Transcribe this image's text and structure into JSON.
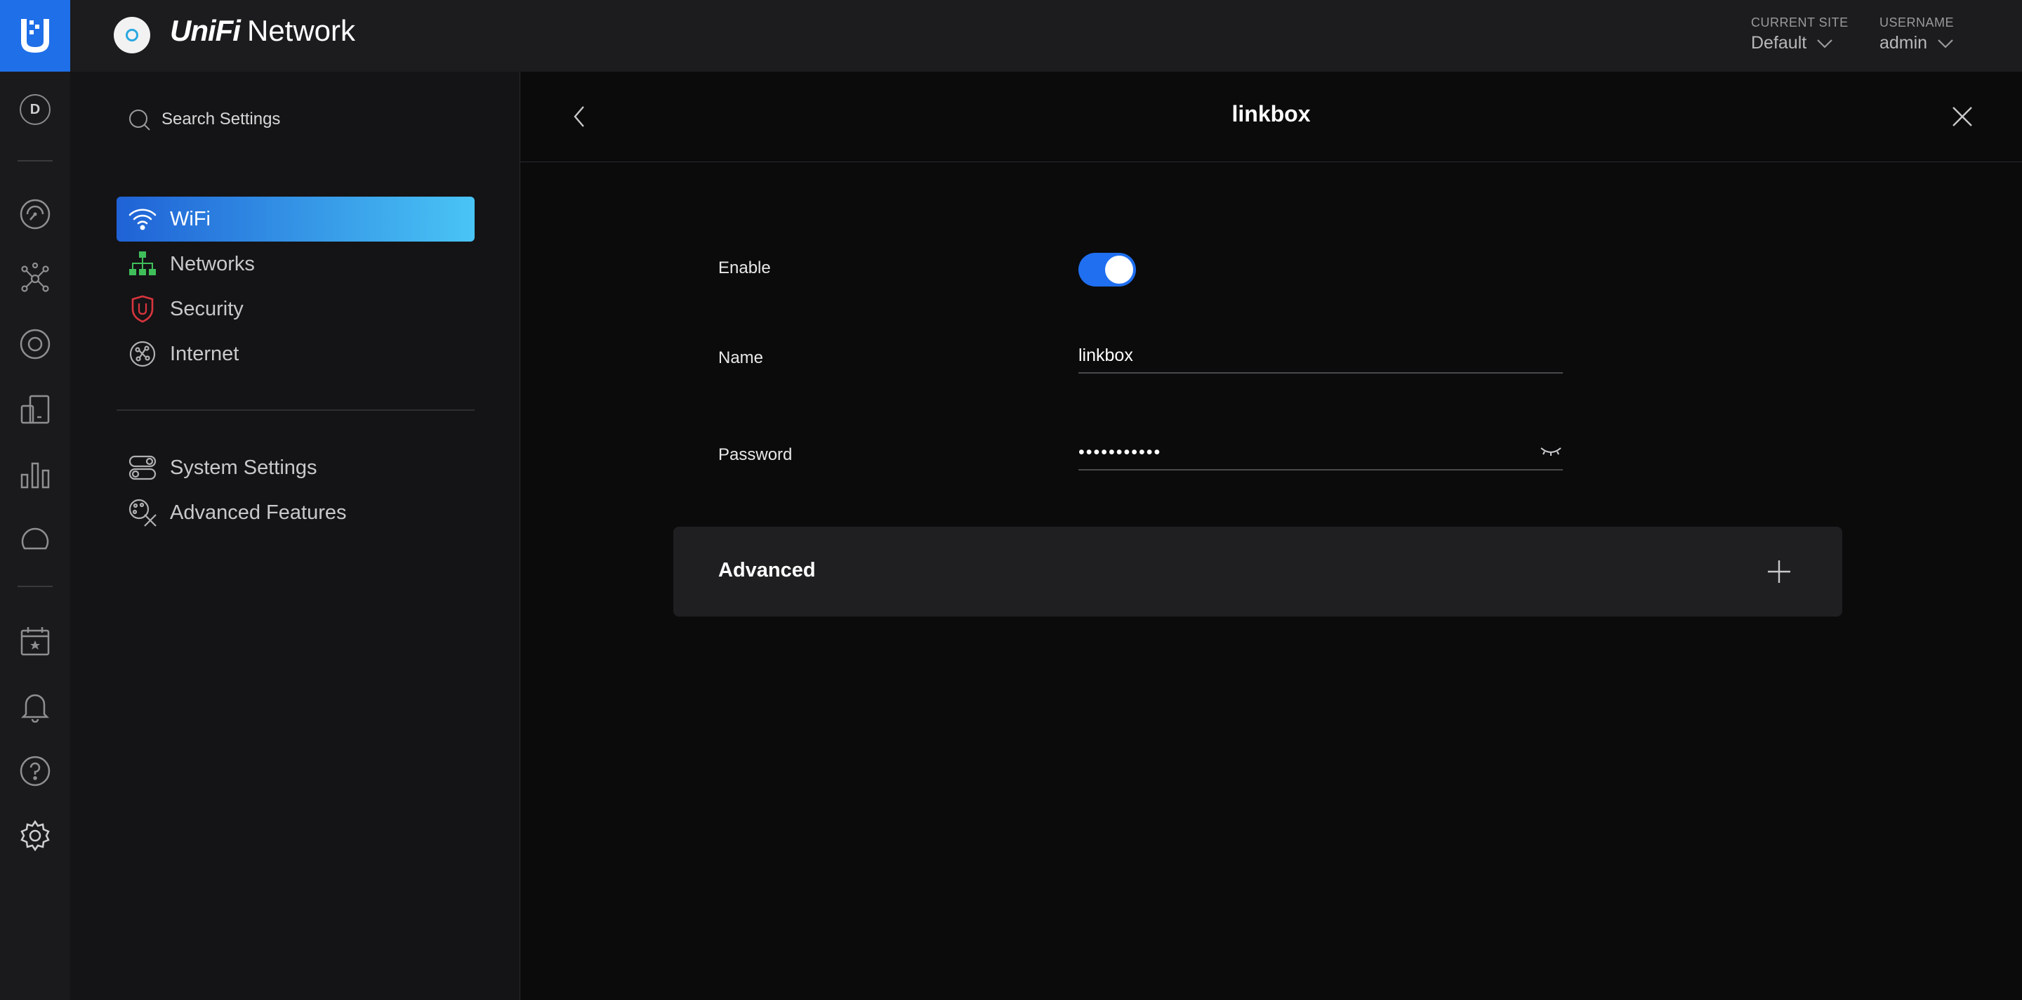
{
  "header": {
    "brand_unifi": "UniFi",
    "brand_network": "Network",
    "current_site_label": "CURRENT SITE",
    "current_site_value": "Default",
    "username_label": "USERNAME",
    "username_value": "admin"
  },
  "rail": {
    "avatar_letter": "D",
    "icons": [
      "dashboard-icon",
      "topology-icon",
      "devices-icon",
      "clients-icon",
      "statistics-icon",
      "insights-icon",
      "events-icon",
      "alerts-icon",
      "help-icon",
      "settings-icon"
    ]
  },
  "settings_nav": {
    "search_placeholder": "Search Settings",
    "items": [
      {
        "label": "WiFi",
        "icon": "wifi-icon",
        "active": true
      },
      {
        "label": "Networks",
        "icon": "networks-icon",
        "color": "#3fbf5a"
      },
      {
        "label": "Security",
        "icon": "shield-icon",
        "color": "#d9353d"
      },
      {
        "label": "Internet",
        "icon": "globe-icon"
      }
    ],
    "items2": [
      {
        "label": "System Settings",
        "icon": "toggles-icon"
      },
      {
        "label": "Advanced Features",
        "icon": "tools-icon"
      }
    ]
  },
  "main": {
    "title": "linkbox",
    "enable_label": "Enable",
    "enable_on": true,
    "name_label": "Name",
    "name_value": "linkbox",
    "password_label": "Password",
    "password_masked": "•••••••••••",
    "advanced_label": "Advanced"
  },
  "colors": {
    "accent": "#1f6ff0",
    "rail_logo": "#1f6fe8",
    "active_gradient_start": "#1f62d6",
    "active_gradient_end": "#49c4f5"
  }
}
